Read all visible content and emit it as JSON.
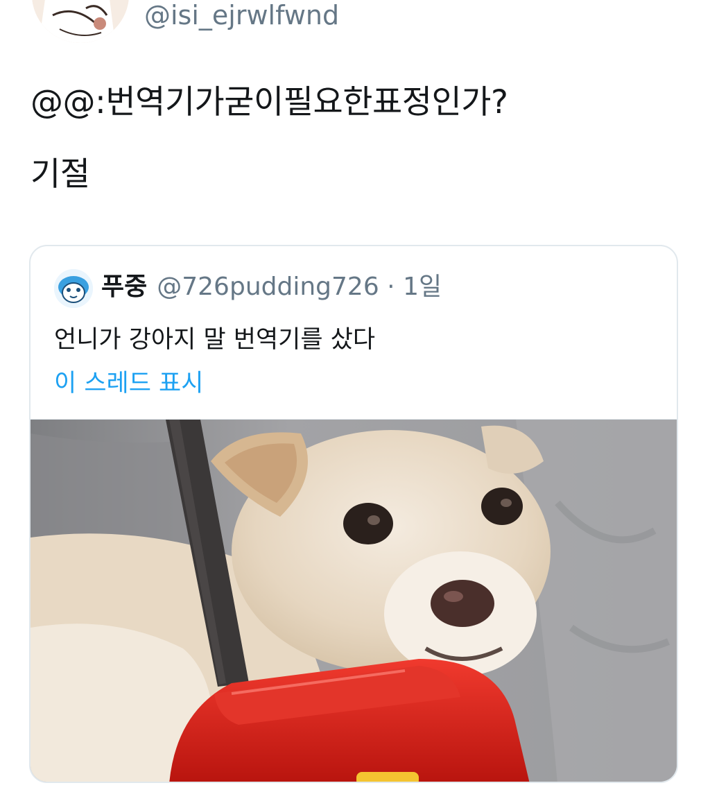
{
  "author": {
    "handle": "@isi_ejrwlfwnd"
  },
  "tweet": {
    "line1": "@@:번역기가굳이필요한표정인가?",
    "line2": "기절"
  },
  "quoted_tweet": {
    "name": "푸중",
    "handle": "@726pudding726",
    "separator": "·",
    "time": "1일",
    "text": "언니가 강아지 말 번역기를 샀다",
    "show_thread": "이 스레드 표시"
  },
  "colors": {
    "link": "#1da1f2",
    "secondary_text": "#657786",
    "primary_text": "#14171a",
    "card_border": "#e1e8ed",
    "device_red": "#d91e18"
  },
  "icons": {
    "author_avatar": "avatar-illustration",
    "quote_avatar": "avatar-cartoon"
  }
}
